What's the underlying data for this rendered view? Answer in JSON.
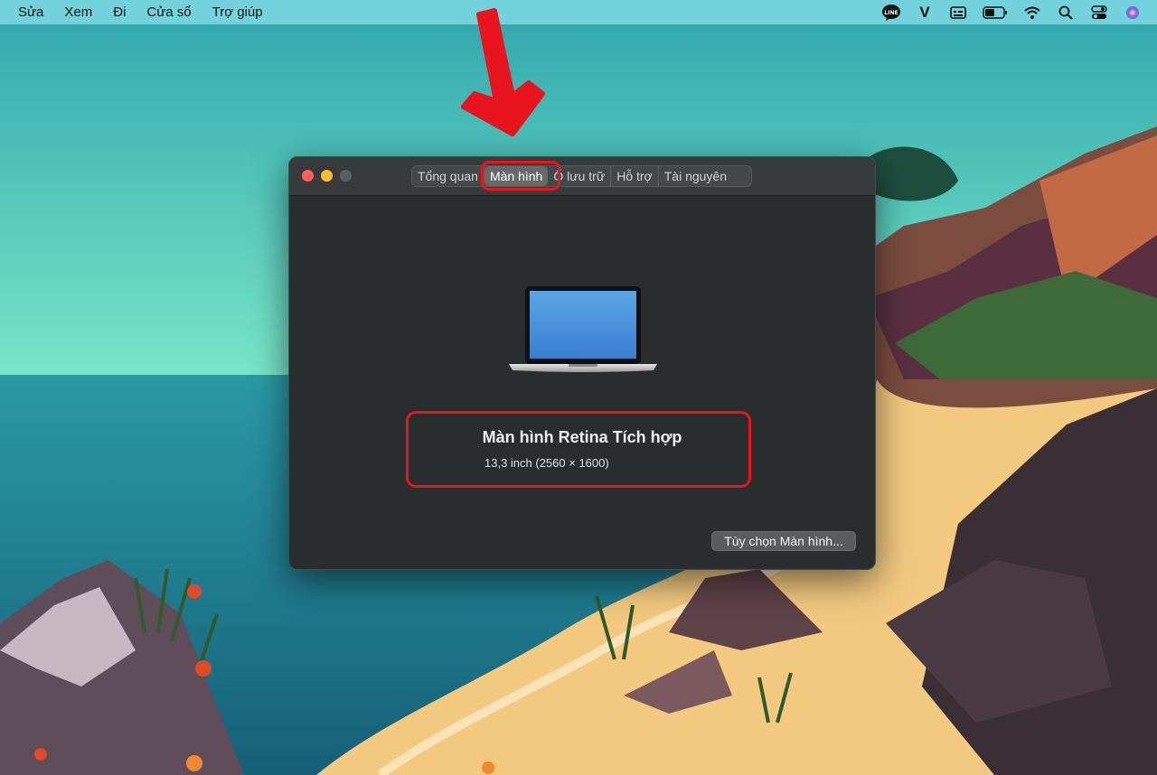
{
  "menubar": {
    "items": [
      "Sửa",
      "Xem",
      "Đi",
      "Cửa sổ",
      "Trợ giúp"
    ],
    "status_icons": [
      "line-app-icon",
      "v-app-icon",
      "keyboard-icon",
      "battery-icon",
      "wifi-icon",
      "search-icon",
      "control-center-icon",
      "siri-icon"
    ],
    "line_text": "LINE",
    "v_text": "V"
  },
  "window": {
    "tabs": [
      "Tổng quan",
      "Màn hình",
      "Ổ lưu trữ",
      "Hỗ trợ",
      "Tài nguyên"
    ],
    "active_tab": "Màn hình",
    "display": {
      "name": "Màn hình Retina Tích hợp",
      "spec": "13,3 inch (2560 × 1600)"
    },
    "display_options_label": "Tùy chọn Màn hình..."
  },
  "colors": {
    "annotation": "#e8141e",
    "sky": "#3fb2b6",
    "sea": "#1f7f91",
    "sand": "#f2c97f",
    "window_bg": "#2a2d2e"
  }
}
